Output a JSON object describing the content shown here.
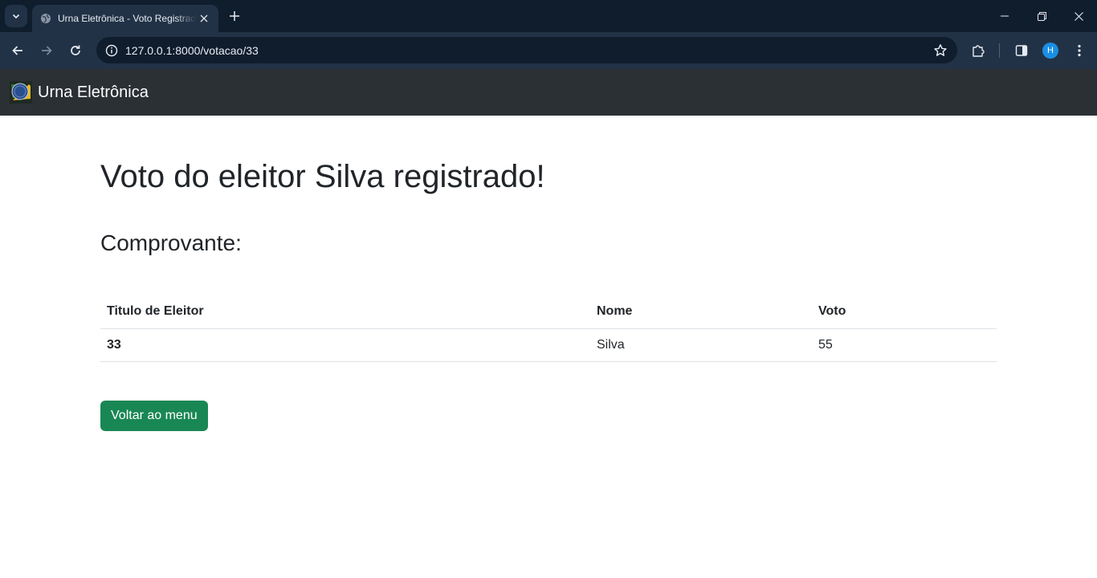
{
  "browser": {
    "tab_title": "Urna Eletrônica - Voto Registrado",
    "url": "127.0.0.1:8000/votacao/33",
    "profile_initial": "H",
    "icons": {
      "tab_search": "chevron-down-icon",
      "favicon": "globe-icon",
      "tab_close": "close-icon",
      "new_tab": "plus-icon",
      "back": "arrow-left-icon",
      "forward": "arrow-right-icon",
      "reload": "reload-icon",
      "site_info": "info-icon",
      "bookmark": "star-icon",
      "extensions": "puzzle-icon",
      "side_panel": "side-panel-icon",
      "menu": "kebab-icon",
      "minimize": "minimize-icon",
      "restore": "restore-icon",
      "close_window": "close-icon"
    }
  },
  "navbar": {
    "brand": "Urna Eletrônica"
  },
  "main": {
    "title": "Voto do eleitor Silva registrado!",
    "subtitle": "Comprovante:",
    "table": {
      "headers": [
        "Titulo de Eleitor",
        "Nome",
        "Voto"
      ],
      "rows": [
        [
          "33",
          "Silva",
          "55"
        ]
      ]
    },
    "back_button": "Voltar ao menu"
  },
  "colors": {
    "navbar_bg": "#2b3035",
    "button_bg": "#198754",
    "text": "#212529"
  }
}
